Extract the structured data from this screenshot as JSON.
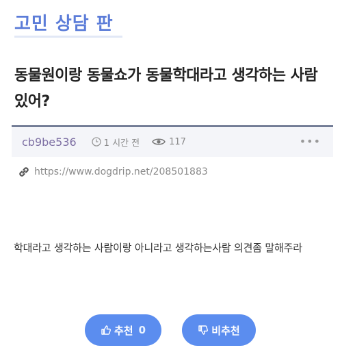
{
  "board": {
    "title": "고민 상담 판"
  },
  "post": {
    "title": "동물원이랑 동물쇼가 동물학대라고 생각하는 사람있어?",
    "author": "cb9be536",
    "time": "1 시간 전",
    "views": "117",
    "more": "•••",
    "link": "https://www.dogdrip.net/208501883",
    "body": "학대라고 생각하는 사람이랑 아니라고 생각하는사람 의견좀 말해주라"
  },
  "vote": {
    "up_label": "추천",
    "up_count": "0",
    "down_label": "비추천"
  },
  "colors": {
    "accent": "#5b7cd8",
    "button": "#5b8def",
    "author": "#7d6fa3"
  }
}
